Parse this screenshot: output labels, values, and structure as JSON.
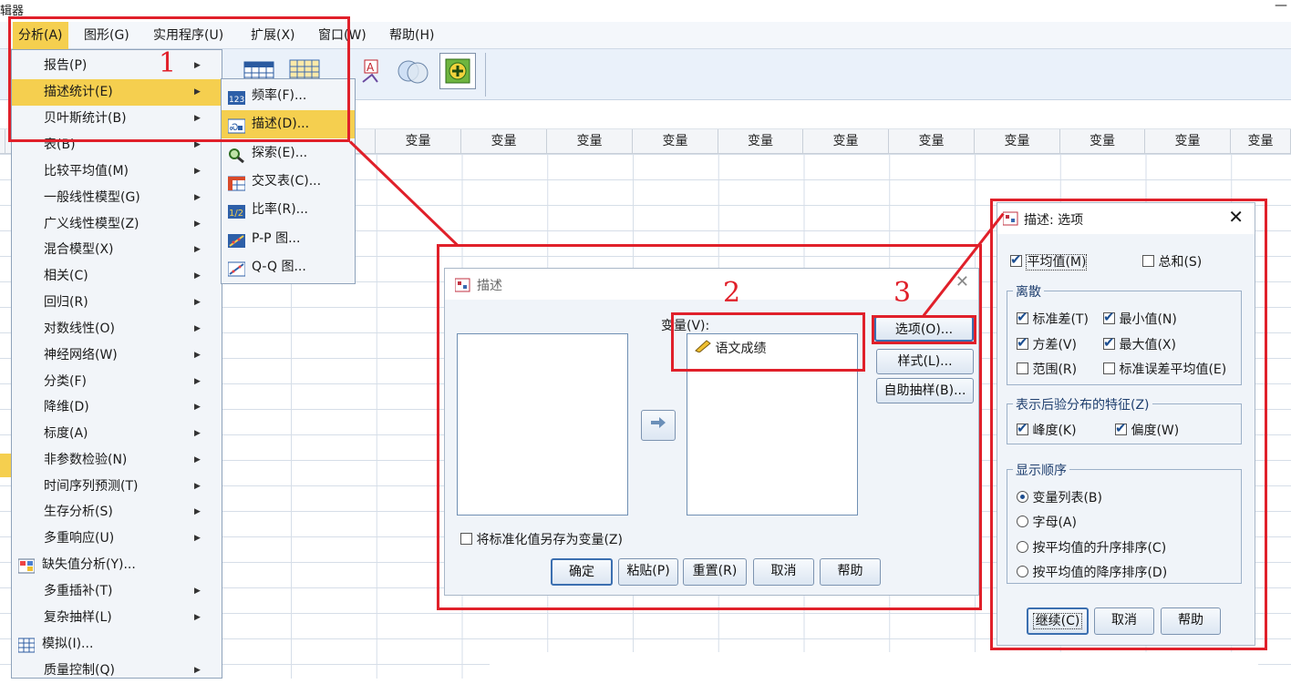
{
  "window": {
    "title_fragment": "辑器",
    "minimize_glyph": "—"
  },
  "menubar": {
    "items": [
      "分析(A)",
      "图形(G)",
      "实用程序(U)",
      "扩展(X)",
      "窗口(W)",
      "帮助(H)"
    ]
  },
  "grid": {
    "column_header": "变量",
    "column_headers": [
      "变量",
      "变量",
      "变量",
      "变量",
      "变量",
      "变量",
      "变量",
      "变量",
      "变量",
      "变量",
      "变量",
      "变量"
    ]
  },
  "analyze_menu": {
    "items": [
      "报告(P)",
      "描述统计(E)",
      "贝叶斯统计(B)",
      "表(B)",
      "比较平均值(M)",
      "一般线性模型(G)",
      "广义线性模型(Z)",
      "混合模型(X)",
      "相关(C)",
      "回归(R)",
      "对数线性(O)",
      "神经网络(W)",
      "分类(F)",
      "降维(D)",
      "标度(A)",
      "非参数检验(N)",
      "时间序列预测(T)",
      "生存分析(S)",
      "多重响应(U)",
      "缺失值分析(Y)...",
      "多重插补(T)",
      "复杂抽样(L)",
      "模拟(I)...",
      "质量控制(Q)"
    ],
    "highlighted_index": 1
  },
  "descriptive_submenu": {
    "items": [
      "频率(F)...",
      "描述(D)...",
      "探索(E)...",
      "交叉表(C)...",
      "比率(R)...",
      "P-P 图...",
      "Q-Q 图..."
    ],
    "highlighted_index": 1
  },
  "describe_dialog": {
    "title": "描述",
    "variables_label": "变量(V):",
    "variables": [
      "语文成绩"
    ],
    "buttons_side": [
      "选项(O)...",
      "样式(L)...",
      "自助抽样(B)..."
    ],
    "save_standardized_label": "将标准化值另存为变量(Z)",
    "save_standardized_checked": false,
    "buttons_bottom": [
      "确定",
      "粘贴(P)",
      "重置(R)",
      "取消",
      "帮助"
    ]
  },
  "options_dialog": {
    "title": "描述: 选项",
    "mean": {
      "label": "平均值(M)",
      "checked": true
    },
    "sum": {
      "label": "总和(S)",
      "checked": false
    },
    "dispersion_title": "离散",
    "dispersion": [
      {
        "label": "标准差(T)",
        "checked": true
      },
      {
        "label": "最小值(N)",
        "checked": true
      },
      {
        "label": "方差(V)",
        "checked": true
      },
      {
        "label": "最大值(X)",
        "checked": true
      },
      {
        "label": "范围(R)",
        "checked": false
      },
      {
        "label": "标准误差平均值(E)",
        "checked": false
      }
    ],
    "distribution_title": "表示后验分布的特征(Z)",
    "distribution": [
      {
        "label": "峰度(K)",
        "checked": true
      },
      {
        "label": "偏度(W)",
        "checked": true
      }
    ],
    "order_title": "显示顺序",
    "order": [
      {
        "label": "变量列表(B)",
        "selected": true
      },
      {
        "label": "字母(A)",
        "selected": false
      },
      {
        "label": "按平均值的升序排序(C)",
        "selected": false
      },
      {
        "label": "按平均值的降序排序(D)",
        "selected": false
      }
    ],
    "buttons": [
      "继续(C)",
      "取消",
      "帮助"
    ]
  },
  "annotations": {
    "step1": "1",
    "step2": "2",
    "step3": "3",
    "color": "#e0202a"
  },
  "colors": {
    "highlight": "#f5cf4f",
    "annotation_red": "#e0202a",
    "toolbar_bg": "#eaf1fa"
  }
}
